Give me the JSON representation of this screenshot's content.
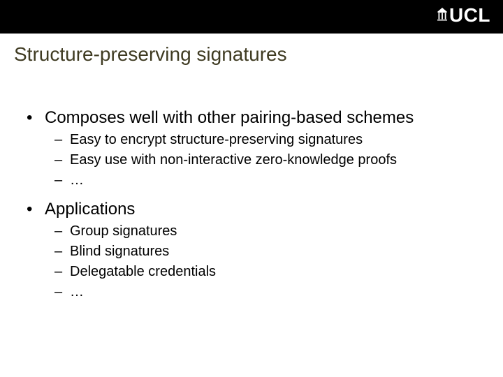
{
  "brand": {
    "logo_text": "UCL"
  },
  "slide": {
    "title": "Structure-preserving signatures",
    "bullets": [
      {
        "text": "Composes well with other pairing-based schemes",
        "subs": [
          {
            "text": "Easy to encrypt structure-preserving signatures"
          },
          {
            "text": "Easy use with non-interactive zero-knowledge proofs"
          },
          {
            "text": "…"
          }
        ]
      },
      {
        "text": "Applications",
        "subs": [
          {
            "text": "Group signatures"
          },
          {
            "text": "Blind signatures"
          },
          {
            "text": "Delegatable credentials"
          },
          {
            "text": "…"
          }
        ]
      }
    ]
  }
}
